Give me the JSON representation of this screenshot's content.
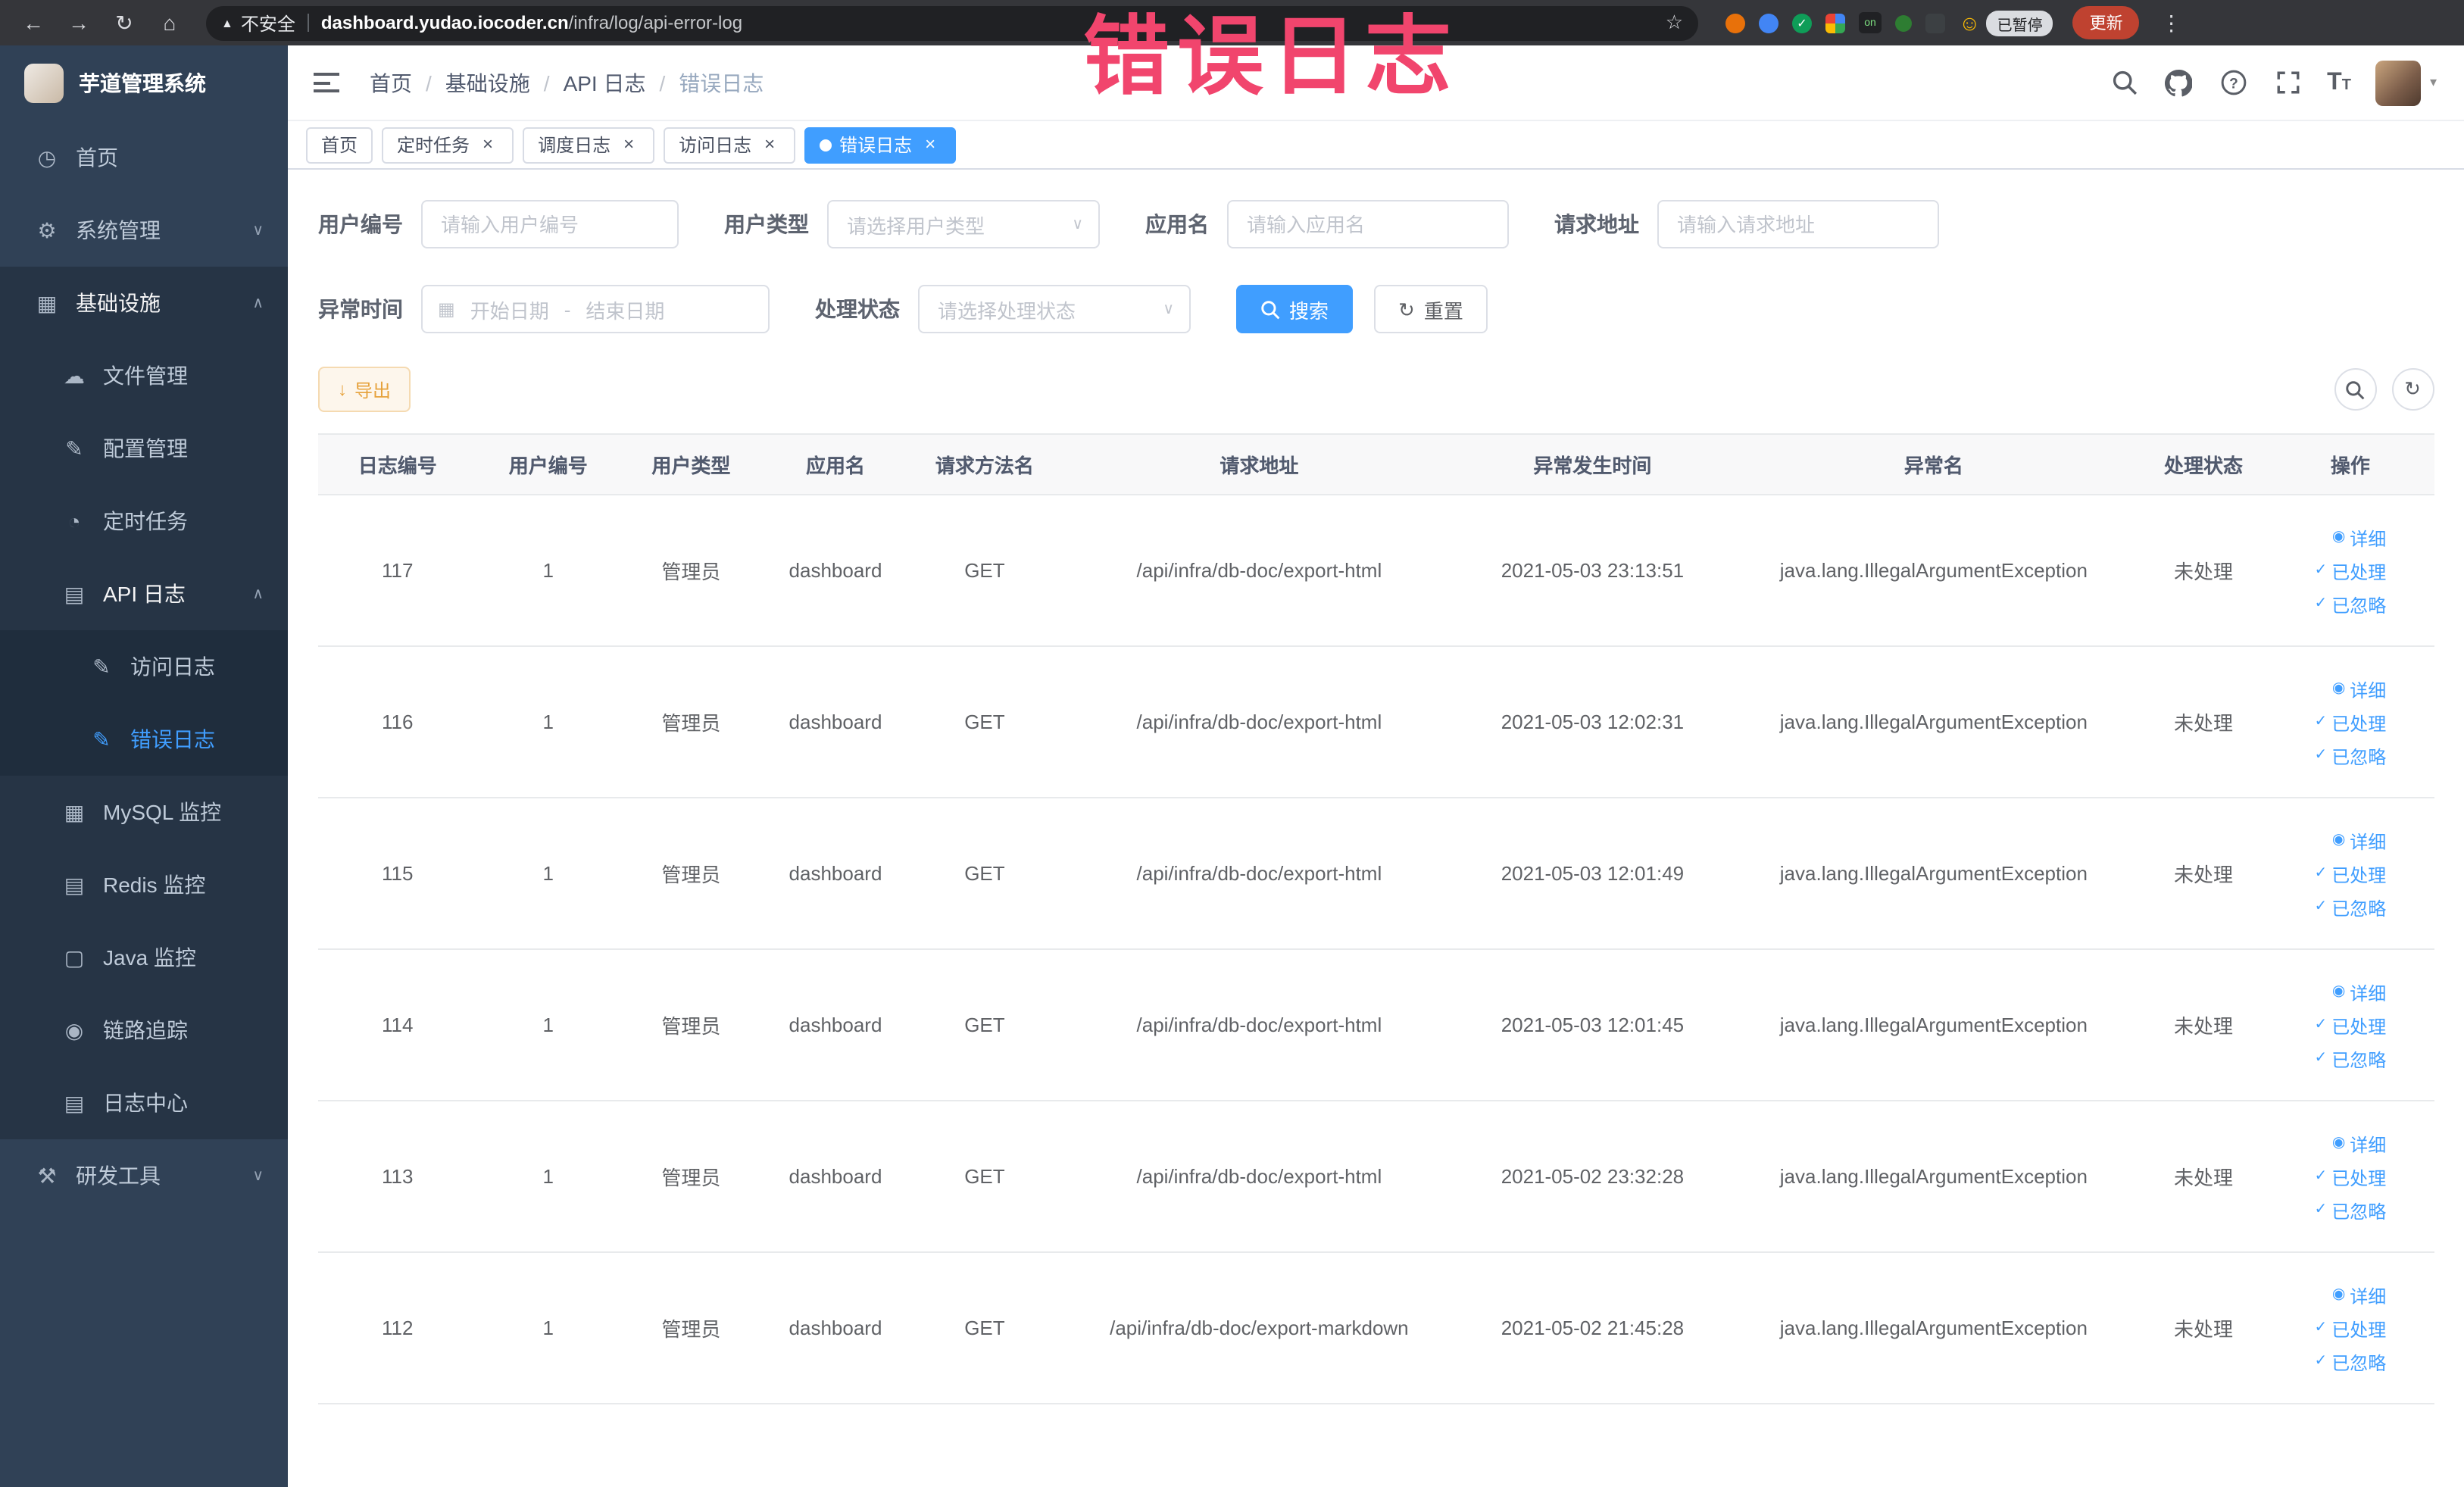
{
  "annotation": {
    "text": "错误日志"
  },
  "browser": {
    "security_label": "不安全",
    "url_host": "dashboard.yudao.iocoder.cn",
    "url_path": "/infra/log/api-error-log",
    "extension_badge": "已暂停",
    "update_button": "更新",
    "ublock_text": "on"
  },
  "sidebar": {
    "app_title": "芋道管理系统",
    "items": {
      "home": "首页",
      "system": "系统管理",
      "infra": "基础设施",
      "file": "文件管理",
      "config": "配置管理",
      "job": "定时任务",
      "api_log": "API 日志",
      "access_log": "访问日志",
      "error_log": "错误日志",
      "mysql": "MySQL 监控",
      "redis": "Redis 监控",
      "java": "Java 监控",
      "trace": "链路追踪",
      "log_center": "日志中心",
      "dev_tools": "研发工具"
    }
  },
  "breadcrumb": [
    "首页",
    "基础设施",
    "API 日志",
    "错误日志"
  ],
  "tabs": [
    {
      "label": "首页",
      "closable": false,
      "active": false
    },
    {
      "label": "定时任务",
      "closable": true,
      "active": false
    },
    {
      "label": "调度日志",
      "closable": true,
      "active": false
    },
    {
      "label": "访问日志",
      "closable": true,
      "active": false
    },
    {
      "label": "错误日志",
      "closable": true,
      "active": true
    }
  ],
  "filters": {
    "user_id": {
      "label": "用户编号",
      "placeholder": "请输入用户编号"
    },
    "user_type": {
      "label": "用户类型",
      "placeholder": "请选择用户类型"
    },
    "app_name": {
      "label": "应用名",
      "placeholder": "请输入应用名"
    },
    "request_url": {
      "label": "请求地址",
      "placeholder": "请输入请求地址"
    },
    "exception_time": {
      "label": "异常时间",
      "start_placeholder": "开始日期",
      "separator": "-",
      "end_placeholder": "结束日期"
    },
    "process_status": {
      "label": "处理状态",
      "placeholder": "请选择处理状态"
    },
    "search_button": "搜索",
    "reset_button": "重置"
  },
  "toolbar": {
    "export_button": "导出"
  },
  "table": {
    "columns": [
      "日志编号",
      "用户编号",
      "用户类型",
      "应用名",
      "请求方法名",
      "请求地址",
      "异常发生时间",
      "异常名",
      "处理状态",
      "操作"
    ],
    "row_actions": [
      "详细",
      "已处理",
      "已忽略"
    ],
    "rows": [
      {
        "id": "117",
        "user_id": "1",
        "user_type": "管理员",
        "app_name": "dashboard",
        "method": "GET",
        "url": "/api/infra/db-doc/export-html",
        "time": "2021-05-03 23:13:51",
        "exception": "java.lang.IllegalArgumentException",
        "status": "未处理"
      },
      {
        "id": "116",
        "user_id": "1",
        "user_type": "管理员",
        "app_name": "dashboard",
        "method": "GET",
        "url": "/api/infra/db-doc/export-html",
        "time": "2021-05-03 12:02:31",
        "exception": "java.lang.IllegalArgumentException",
        "status": "未处理"
      },
      {
        "id": "115",
        "user_id": "1",
        "user_type": "管理员",
        "app_name": "dashboard",
        "method": "GET",
        "url": "/api/infra/db-doc/export-html",
        "time": "2021-05-03 12:01:49",
        "exception": "java.lang.IllegalArgumentException",
        "status": "未处理"
      },
      {
        "id": "114",
        "user_id": "1",
        "user_type": "管理员",
        "app_name": "dashboard",
        "method": "GET",
        "url": "/api/infra/db-doc/export-html",
        "time": "2021-05-03 12:01:45",
        "exception": "java.lang.IllegalArgumentException",
        "status": "未处理"
      },
      {
        "id": "113",
        "user_id": "1",
        "user_type": "管理员",
        "app_name": "dashboard",
        "method": "GET",
        "url": "/api/infra/db-doc/export-html",
        "time": "2021-05-02 23:32:28",
        "exception": "java.lang.IllegalArgumentException",
        "status": "未处理"
      },
      {
        "id": "112",
        "user_id": "1",
        "user_type": "管理员",
        "app_name": "dashboard",
        "method": "GET",
        "url": "/api/infra/db-doc/export-markdown",
        "time": "2021-05-02 21:45:28",
        "exception": "java.lang.IllegalArgumentException",
        "status": "未处理"
      }
    ]
  },
  "colors": {
    "primary": "#409eff",
    "warning": "#e6a23c",
    "annotation": "#f1456d",
    "sidebar_bg": "#304156"
  },
  "icons": {
    "back": "←",
    "forward": "→",
    "reload": "↻",
    "home": "⌂",
    "warning": "▲",
    "star": "☆",
    "dots": "⋮",
    "dashboard": "◷",
    "gear": "⚙",
    "monitor": "▦",
    "cloud": "☁",
    "edit": "✎",
    "clock": "◔",
    "doc": "▤",
    "grid": "▦",
    "layers": "▤",
    "screen": "▢",
    "eye": "◉",
    "tools": "⚒",
    "chevron-down": "∨",
    "chevron-up": "∧",
    "caret-down": "▾",
    "close": "×",
    "check": "✓",
    "download": "↓",
    "refresh": "↻",
    "calendar": "▦",
    "arrow-down-small": "∨",
    "smiley": "☺"
  }
}
